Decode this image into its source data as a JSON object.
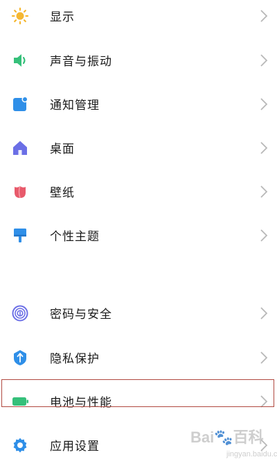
{
  "settings": {
    "items": [
      {
        "label": "显示",
        "icon": "sun-icon",
        "color": "#f5b731"
      },
      {
        "label": "声音与振动",
        "icon": "speaker-icon",
        "color": "#35c07a"
      },
      {
        "label": "通知管理",
        "icon": "notification-icon",
        "color": "#2f8fe8"
      },
      {
        "label": "桌面",
        "icon": "home-icon",
        "color": "#6b6fe6"
      },
      {
        "label": "壁纸",
        "icon": "tulip-icon",
        "color": "#e85a6b"
      },
      {
        "label": "个性主题",
        "icon": "brush-icon",
        "color": "#2f8fe8"
      },
      {
        "label": "密码与安全",
        "icon": "fingerprint-icon",
        "color": "#6b6fe6"
      },
      {
        "label": "隐私保护",
        "icon": "shield-icon",
        "color": "#2f8fe8"
      },
      {
        "label": "电池与性能",
        "icon": "battery-icon",
        "color": "#35c07a"
      },
      {
        "label": "应用设置",
        "icon": "gear-icon",
        "color": "#2f8fe8"
      }
    ]
  },
  "watermark": {
    "logo": "Bai🐾百科",
    "sub": "jingyan.baidu.com"
  },
  "highlight_color": "#b0483f"
}
